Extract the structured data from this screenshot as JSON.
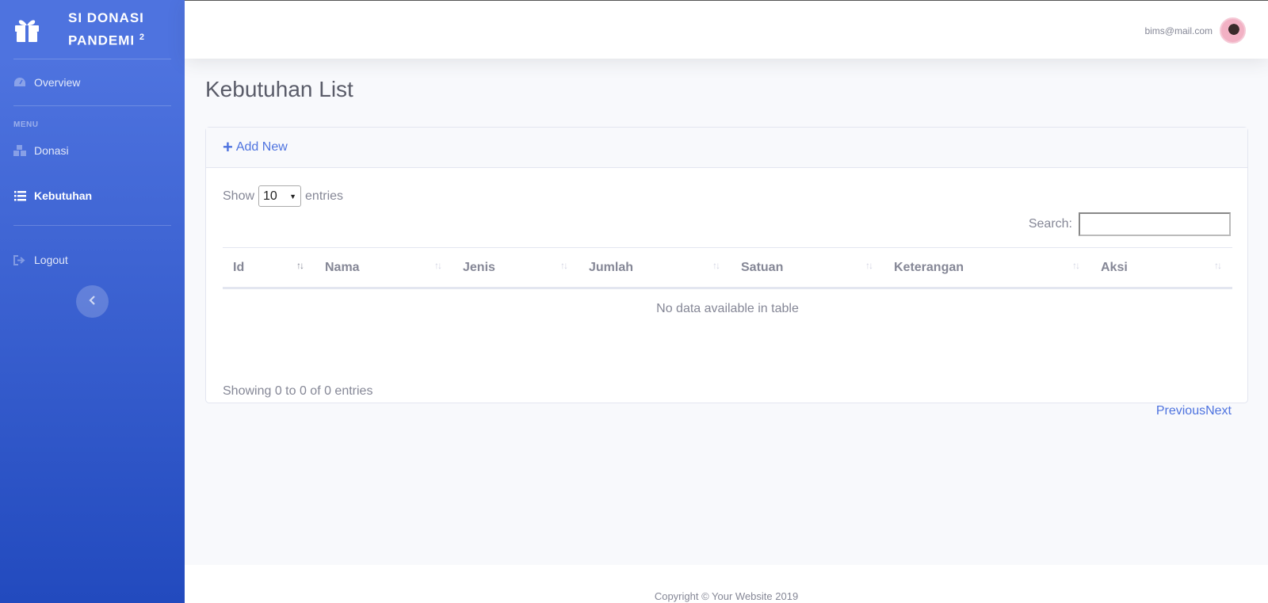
{
  "sidebar": {
    "brand_line1": "SI DONASI",
    "brand_line2": "PANDEMI",
    "brand_sup": "2",
    "brand_icon": "gift-icon",
    "items": [
      {
        "label": "Overview",
        "icon": "tachometer-icon"
      },
      {
        "label": "Donasi",
        "icon": "boxes-icon"
      },
      {
        "label": "Kebutuhan",
        "icon": "list-icon",
        "active": true
      },
      {
        "label": "Logout",
        "icon": "sign-out-icon"
      }
    ],
    "heading": "MENU",
    "toggle_icon": "chevron-left-icon"
  },
  "topbar": {
    "user_email": "bims@mail.com"
  },
  "page": {
    "title": "Kebutuhan List",
    "add_new": "Add New",
    "show_label": "Show",
    "entries_label": "entries",
    "page_length": "10",
    "search_label": "Search:",
    "search_value": ""
  },
  "table": {
    "columns": [
      "Id",
      "Nama",
      "Jenis",
      "Jumlah",
      "Satuan",
      "Keterangan",
      "Aksi"
    ],
    "empty_message": "No data available in table"
  },
  "pagination": {
    "info": "Showing 0 to 0 of 0 entries",
    "previous": "Previous",
    "next": "Next"
  },
  "footer": {
    "copyright": "Copyright © Your Website 2019"
  },
  "colors": {
    "primary": "#4e73df",
    "primary_dark": "#224abe",
    "text_muted": "#858796"
  }
}
